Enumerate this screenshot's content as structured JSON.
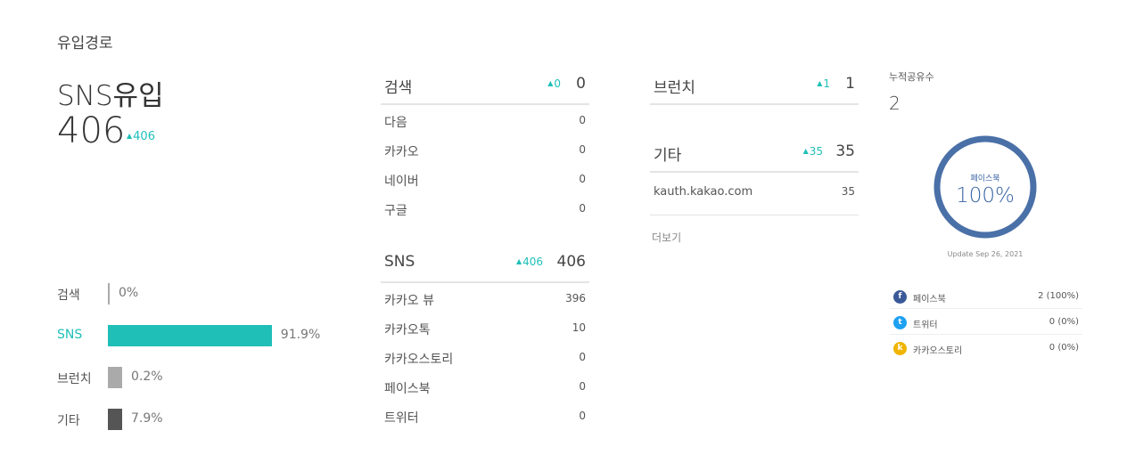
{
  "section_title": "유입경로",
  "summary": {
    "label": "SNS유입",
    "value": "406",
    "delta": "406"
  },
  "bars": [
    {
      "label": "검색",
      "value": "0%",
      "pct": 0,
      "color": "#cccccc",
      "active": false
    },
    {
      "label": "SNS",
      "value": "91.9%",
      "pct": 91.9,
      "color": "#1fbfb8",
      "active": true
    },
    {
      "label": "브런치",
      "value": "0.2%",
      "pct": 0.2,
      "color": "#cccccc",
      "active": false
    },
    {
      "label": "기타",
      "value": "7.9%",
      "pct": 7.9,
      "color": "#555555",
      "active": false
    }
  ],
  "search": {
    "label": "검색",
    "delta": "0",
    "total": "0",
    "rows": [
      {
        "label": "다음",
        "value": "0"
      },
      {
        "label": "카카오",
        "value": "0"
      },
      {
        "label": "네이버",
        "value": "0"
      },
      {
        "label": "구글",
        "value": "0"
      }
    ]
  },
  "sns": {
    "label": "SNS",
    "delta": "406",
    "total": "406",
    "rows": [
      {
        "label": "카카오 뷰",
        "value": "396"
      },
      {
        "label": "카카오톡",
        "value": "10"
      },
      {
        "label": "카카오스토리",
        "value": "0"
      },
      {
        "label": "페이스북",
        "value": "0"
      },
      {
        "label": "트위터",
        "value": "0"
      }
    ]
  },
  "brunch": {
    "label": "브런치",
    "delta": "1",
    "total": "1",
    "rows": []
  },
  "etc": {
    "label": "기타",
    "delta": "35",
    "total": "35",
    "rows": [
      {
        "label": "kauth.kakao.com",
        "value": "35"
      }
    ]
  },
  "more_label": "더보기",
  "share": {
    "label": "누적공유수",
    "value": "2",
    "donut_label": "페이스북",
    "donut_value": "100%",
    "donut_fraction": 1.0,
    "donut_color": "#4a70a8",
    "update_text": "Update Sep 26, 2021",
    "legend": [
      {
        "icon": "facebook-icon",
        "glyph": "f",
        "color": "#3b5998",
        "label": "페이스북",
        "value": "2 (100%)"
      },
      {
        "icon": "twitter-icon",
        "glyph": "t",
        "color": "#1da1f2",
        "label": "트위터",
        "value": "0 (0%)"
      },
      {
        "icon": "kakaostory-icon",
        "glyph": "k",
        "color": "#f0b400",
        "label": "카카오스토리",
        "value": "0 (0%)"
      }
    ]
  }
}
